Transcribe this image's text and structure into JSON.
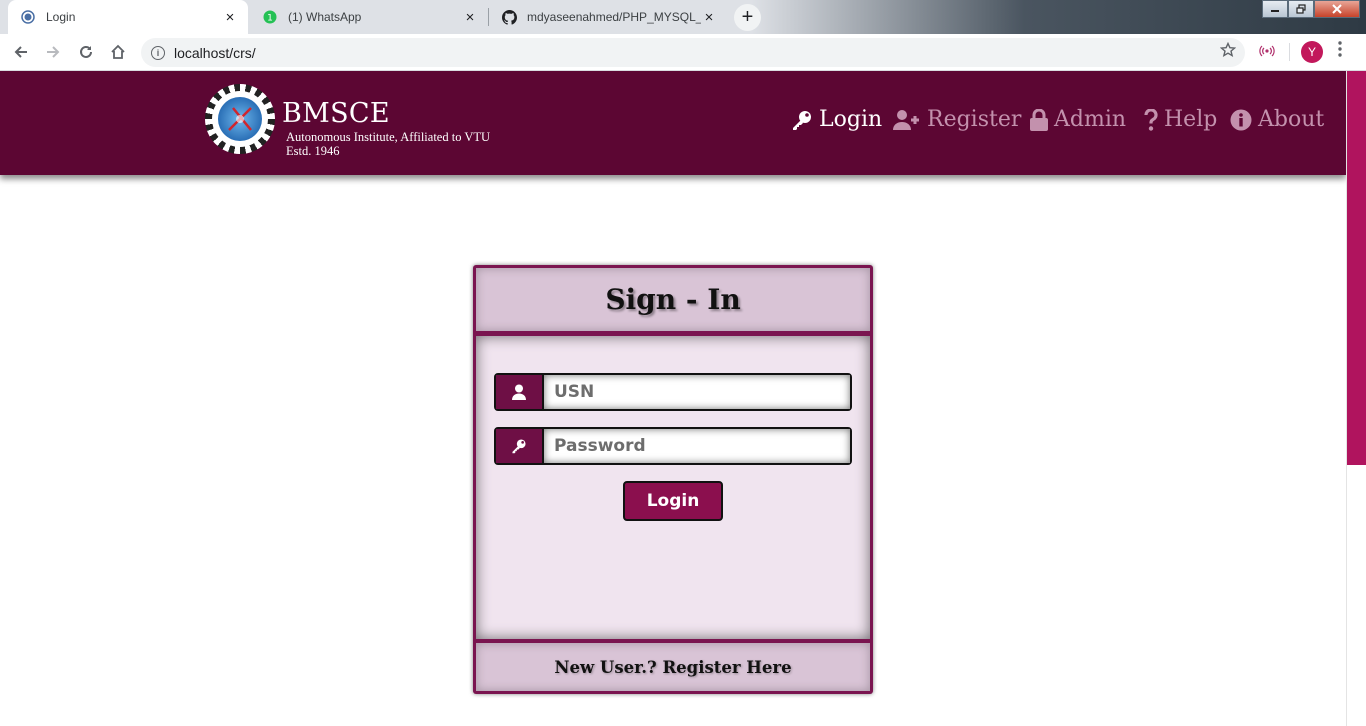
{
  "browser": {
    "tabs": [
      {
        "title": "Login",
        "active": true
      },
      {
        "title": "(1) WhatsApp",
        "active": false
      },
      {
        "title": "mdyaseenahmed/PHP_MYSQL_E",
        "active": false
      }
    ],
    "url": "localhost/crs/",
    "profile_initial": "Y",
    "close_glyph": "×",
    "new_tab_glyph": "+"
  },
  "header": {
    "brand": "BMSCE",
    "tagline_line1": "Autonomous Institute, Affiliated to VTU",
    "tagline_line2": "Estd. 1946",
    "bg_color": "#5c0633",
    "nav": [
      {
        "label": "Login",
        "icon": "key-icon",
        "active": true
      },
      {
        "label": "Register",
        "icon": "user-plus-icon",
        "active": false
      },
      {
        "label": "Admin",
        "icon": "lock-icon",
        "active": false
      },
      {
        "label": "Help",
        "icon": "question-icon",
        "active": false
      },
      {
        "label": "About",
        "icon": "info-circle-icon",
        "active": false
      }
    ]
  },
  "signin": {
    "title": "Sign - In",
    "usn_placeholder": "USN",
    "password_placeholder": "Password",
    "login_button": "Login",
    "register_link": "New User.? Register Here",
    "accent_color": "#8b0f4e"
  }
}
